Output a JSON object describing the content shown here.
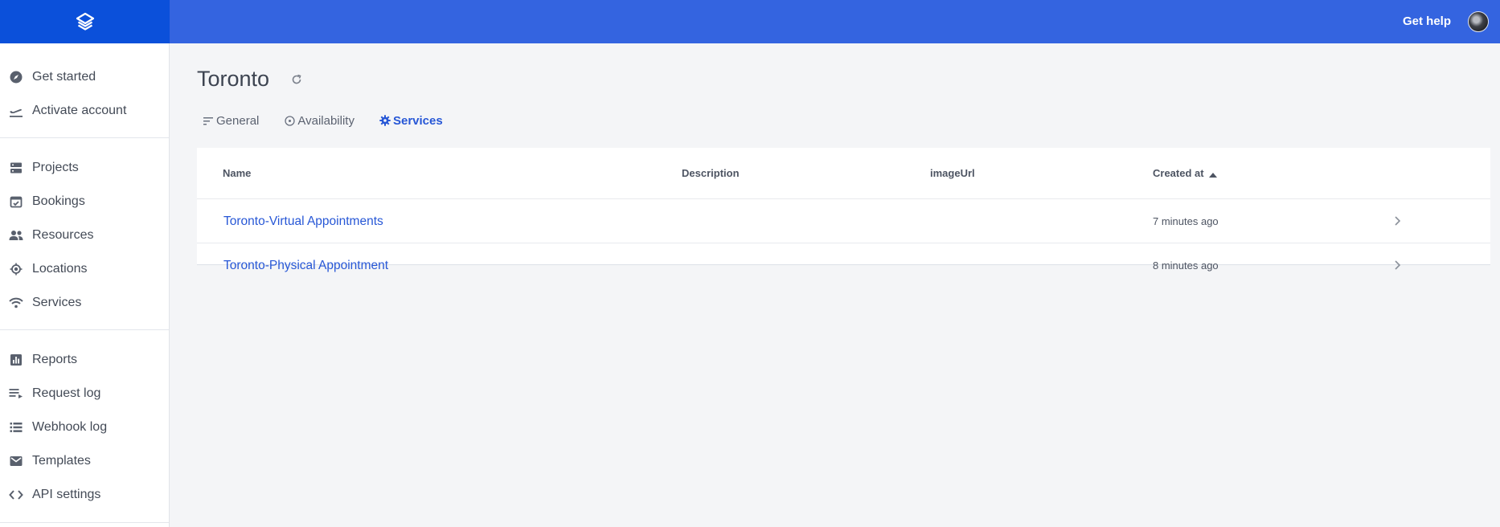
{
  "header": {
    "logo_icon": "layers-logo-icon",
    "get_help_label": "Get help",
    "avatar_icon": "user-avatar",
    "brand_color": "#3464e0",
    "logo_bg_color": "#0b50da"
  },
  "sidebar": {
    "items": [
      {
        "label": "Get started",
        "icon": "compass-icon"
      },
      {
        "label": "Activate account",
        "icon": "plane-takeoff-icon"
      },
      {
        "label": "Projects",
        "icon": "server-icon"
      },
      {
        "label": "Bookings",
        "icon": "calendar-check-icon"
      },
      {
        "label": "Resources",
        "icon": "people-icon"
      },
      {
        "label": "Locations",
        "icon": "location-target-icon"
      },
      {
        "label": "Services",
        "icon": "wifi-icon"
      },
      {
        "label": "Reports",
        "icon": "bar-chart-icon"
      },
      {
        "label": "Request log",
        "icon": "playlist-icon"
      },
      {
        "label": "Webhook log",
        "icon": "list-icon"
      },
      {
        "label": "Templates",
        "icon": "mail-icon"
      },
      {
        "label": "API settings",
        "icon": "code-icon"
      }
    ]
  },
  "page": {
    "title": "Toronto",
    "refresh_icon": "refresh-icon",
    "tabs": [
      {
        "label": "General",
        "icon": "sort-lines-icon",
        "active": false
      },
      {
        "label": "Availability",
        "icon": "target-icon",
        "active": false
      },
      {
        "label": "Services",
        "icon": "gear-icon",
        "active": true
      }
    ],
    "accent_color": "#2757d6"
  },
  "table": {
    "columns": [
      "Name",
      "Description",
      "imageUrl",
      "Created at"
    ],
    "sort_column": "Created at",
    "sort_icon": "sort-up-icon",
    "rows": [
      {
        "name": "Toronto-Virtual Appointments",
        "description": "",
        "imageUrl": "",
        "created_at": "7 minutes ago"
      },
      {
        "name": "Toronto-Physical Appointment",
        "description": "",
        "imageUrl": "",
        "created_at": "8 minutes ago"
      }
    ],
    "row_action_icon": "chevron-right-icon"
  }
}
